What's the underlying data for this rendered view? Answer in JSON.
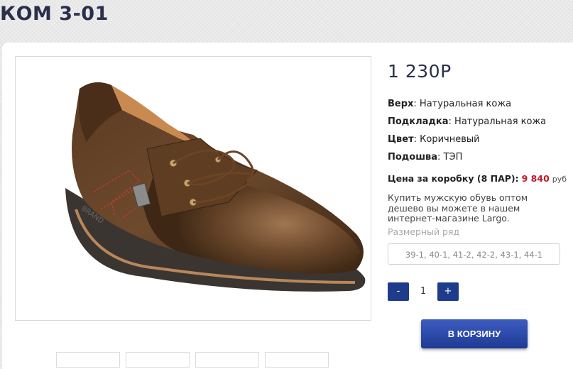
{
  "product": {
    "title": "КОМ 3-01",
    "price": "1 230Р",
    "specs": [
      {
        "label": "Верх",
        "value": ": Натуральная кожа"
      },
      {
        "label": "Подкладка",
        "value": ": Натуральная кожа"
      },
      {
        "label": "Цвет",
        "value": ": Коричневый"
      },
      {
        "label": "Подошва",
        "value": ": ТЭП"
      }
    ],
    "box_price": {
      "label": "Цена за коробку (8 ПАР):",
      "value": "9 840",
      "currency": "руб"
    },
    "promo_text": "Купить мужскую обувь оптом дешево вы можете в нашем интернет-магазине Largo.",
    "size_label": "Размерный ряд",
    "size_value": "39-1, 40-1, 41-2, 42-2, 43-1, 44-1",
    "quantity": {
      "minus": "-",
      "value": "1",
      "plus": "+"
    },
    "cart_button": "В КОРЗИНУ"
  },
  "icons": {
    "photo": "shoe-photo"
  },
  "colors": {
    "accent": "#1f3c8a",
    "price_highlight": "#c0182a",
    "title": "#2a2f4a"
  }
}
